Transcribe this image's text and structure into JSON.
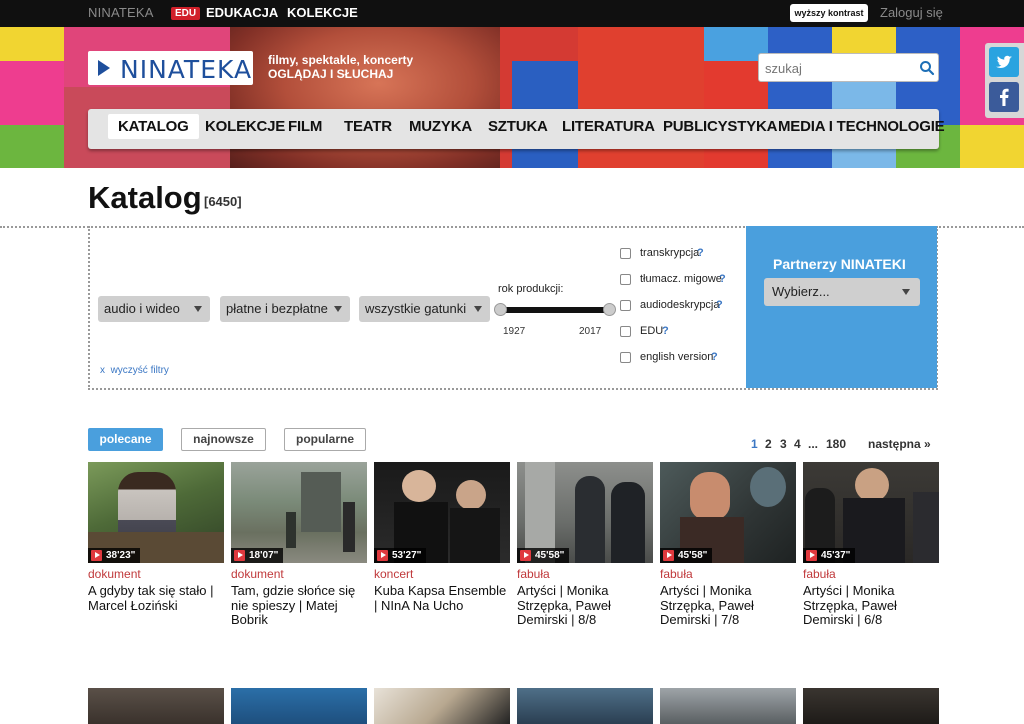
{
  "topbar": {
    "brand": "NINATEKA",
    "edu_badge": "EDU",
    "edu_label": "EDUKACJA",
    "kolekcje_label": "KOLEKCJE",
    "contrast_label": "wyższy kontrast",
    "login_label": "Zaloguj się"
  },
  "header": {
    "logo_text": "NINATEKA",
    "tagline_line1": "filmy, spektakle, koncerty",
    "tagline_line2": "OGLĄDAJ I SŁUCHAJ",
    "search_placeholder": "szukaj"
  },
  "nav": {
    "items": [
      "KATALOG",
      "KOLEKCJE",
      "FILM",
      "TEATR",
      "MUZYKA",
      "SZTUKA",
      "LITERATURA",
      "PUBLICYSTYKA",
      "MEDIA I TECHNOLOGIE"
    ],
    "active": "KATALOG"
  },
  "page": {
    "title": "Katalog",
    "count": "[6450]"
  },
  "filters": {
    "media_select": "audio i wideo",
    "payment_select": "płatne i bezpłatne",
    "genre_select": "wszystkie gatunki",
    "year_label": "rok produkcji:",
    "year_min": "1927",
    "year_max": "2017",
    "clear_label": "wyczyść filtry",
    "clear_x": "x",
    "checkboxes": [
      {
        "label": "transkrypcja",
        "q": "?"
      },
      {
        "label": "tłumacz. migowe",
        "q": "?"
      },
      {
        "label": "audiodeskrypcja",
        "q": "?"
      },
      {
        "label": "EDU",
        "q": "?"
      },
      {
        "label": "english version",
        "q": "?"
      }
    ]
  },
  "partners": {
    "title": "Partnerzy NINATEKI",
    "select": "Wybierz..."
  },
  "sort_tabs": [
    {
      "label": "polecane",
      "active": true
    },
    {
      "label": "najnowsze",
      "active": false
    },
    {
      "label": "popularne",
      "active": false
    }
  ],
  "pagination": {
    "pages": [
      "1",
      "2",
      "3",
      "4",
      "...",
      "180"
    ],
    "current": "1",
    "next_label": "następna »"
  },
  "items": [
    {
      "duration": "38'23\"",
      "category": "dokument",
      "title": "A gdyby tak się stało | Marcel Łoziński"
    },
    {
      "duration": "18'07\"",
      "category": "dokument",
      "title": "Tam, gdzie słońce się nie spieszy | Matej Bobrik"
    },
    {
      "duration": "53'27\"",
      "category": "koncert",
      "title": "Kuba Kapsa Ensemble | NInA Na Ucho"
    },
    {
      "duration": "45'58\"",
      "category": "fabuła",
      "title": "Artyści | Monika Strzępka, Paweł Demirski | 8/8"
    },
    {
      "duration": "45'58\"",
      "category": "fabuła",
      "title": "Artyści | Monika Strzępka, Paweł Demirski | 7/8"
    },
    {
      "duration": "45'37\"",
      "category": "fabuła",
      "title": "Artyści | Monika Strzępka, Paweł Demirski | 6/8"
    }
  ],
  "icons": {
    "search": "search-icon",
    "twitter": "twitter-icon",
    "facebook": "facebook-icon",
    "play": "play-icon"
  },
  "colors": {
    "brand_blue": "#1e4f9c",
    "accent_blue": "#4a9fdd",
    "category_red": "#c0393b",
    "edu_red": "#d1202a"
  }
}
